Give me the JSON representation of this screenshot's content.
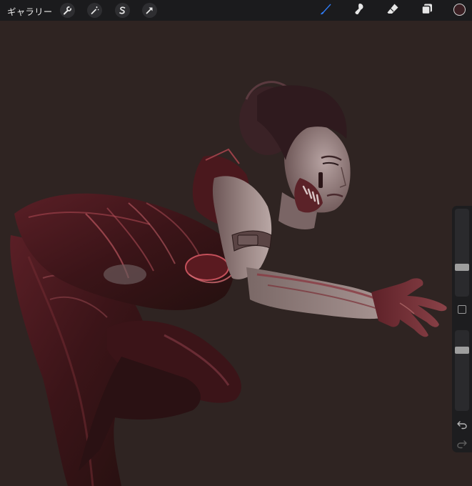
{
  "toolbar": {
    "gallery_label": "ギャラリー",
    "left_tools": [
      "wrench-icon",
      "magic-wand-icon",
      "selection-icon",
      "transform-icon"
    ],
    "right_tools": [
      "brush-icon",
      "smudge-icon",
      "eraser-icon",
      "layers-icon"
    ],
    "active_tool": "brush-icon",
    "accent_color": "#2f7cf6",
    "current_color": "#3a1f23"
  },
  "canvas": {
    "background_color": "#2f2422"
  },
  "sidebar": {
    "brush_size_level": 0.32,
    "opacity_level": 0.78
  }
}
